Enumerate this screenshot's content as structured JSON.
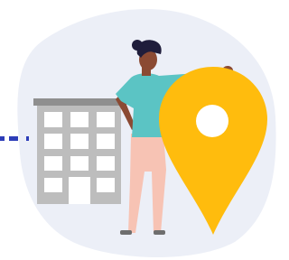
{
  "illustration": {
    "subject": "person-with-location-pin-next-to-building",
    "colors": {
      "background_blob": "#eceff7",
      "building_body": "#bdbdbd",
      "building_roof": "#8f8f8f",
      "building_window": "#ffffff",
      "person_top": "#5bc4c4",
      "person_pants": "#f7c3b4",
      "person_skin": "#8b4a33",
      "person_hair": "#1f1d3b",
      "person_shoe": "#6e6e6e",
      "pin_fill": "#ffbc0d",
      "pin_hole": "#ffffff",
      "dash_accent": "#2d3db8"
    }
  }
}
